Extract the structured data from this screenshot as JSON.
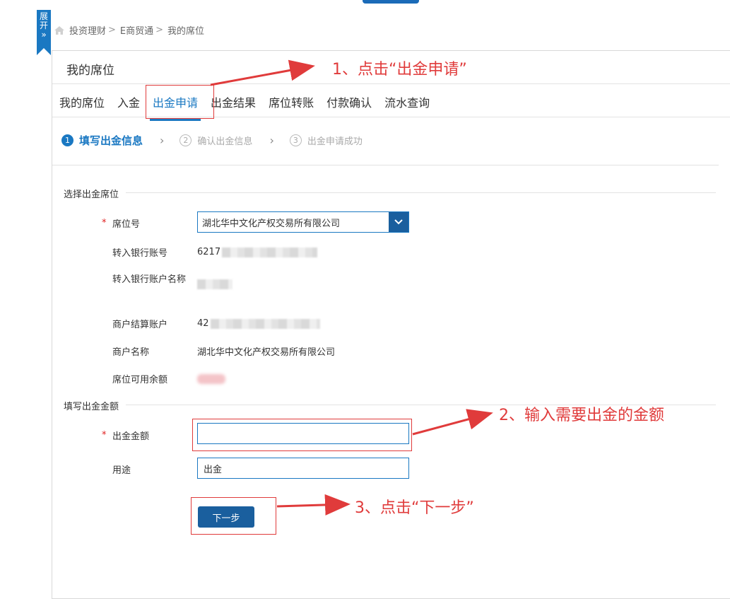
{
  "sidebar_toggle": {
    "label_line1": "展",
    "label_line2": "开",
    "label_line3": "»"
  },
  "breadcrumb": {
    "items": [
      "投资理财",
      "E商贸通",
      "我的席位"
    ],
    "separator": ">"
  },
  "panel": {
    "title": "我的席位"
  },
  "tabs": [
    {
      "label": "我的席位",
      "active": false
    },
    {
      "label": "入金",
      "active": false
    },
    {
      "label": "出金申请",
      "active": true
    },
    {
      "label": "出金结果",
      "active": false
    },
    {
      "label": "席位转账",
      "active": false
    },
    {
      "label": "付款确认",
      "active": false
    },
    {
      "label": "流水查询",
      "active": false
    }
  ],
  "steps": [
    {
      "num": "1",
      "label": "填写出金信息",
      "active": true
    },
    {
      "num": "2",
      "label": "确认出金信息",
      "active": false
    },
    {
      "num": "3",
      "label": "出金申请成功",
      "active": false
    }
  ],
  "section_seat": {
    "title": "选择出金席位",
    "seat_label": "席位号",
    "seat_value": "湖北华中文化产权交易所有限公司",
    "bank_account_label": "转入银行账号",
    "bank_account_prefix": "6217",
    "bank_account_name_label": "转入银行账户名称",
    "merchant_account_label": "商户结算账户",
    "merchant_account_prefix": "42",
    "merchant_name_label": "商户名称",
    "merchant_name_value": "湖北华中文化产权交易所有限公司",
    "balance_label": "席位可用余额"
  },
  "section_amount": {
    "title": "填写出金金额",
    "amount_label": "出金金额",
    "amount_value": "",
    "purpose_label": "用途",
    "purpose_value": "出金"
  },
  "next_button": {
    "label": "下一步"
  },
  "annotations": {
    "a1": "1、点击“出金申请”",
    "a2": "2、输入需要出金的金额",
    "a3": "3、点击“下一步”"
  },
  "colors": {
    "accent": "#1a78c2",
    "button": "#1a5f9e",
    "annotation": "#e03b3b",
    "required": "#e02020"
  }
}
